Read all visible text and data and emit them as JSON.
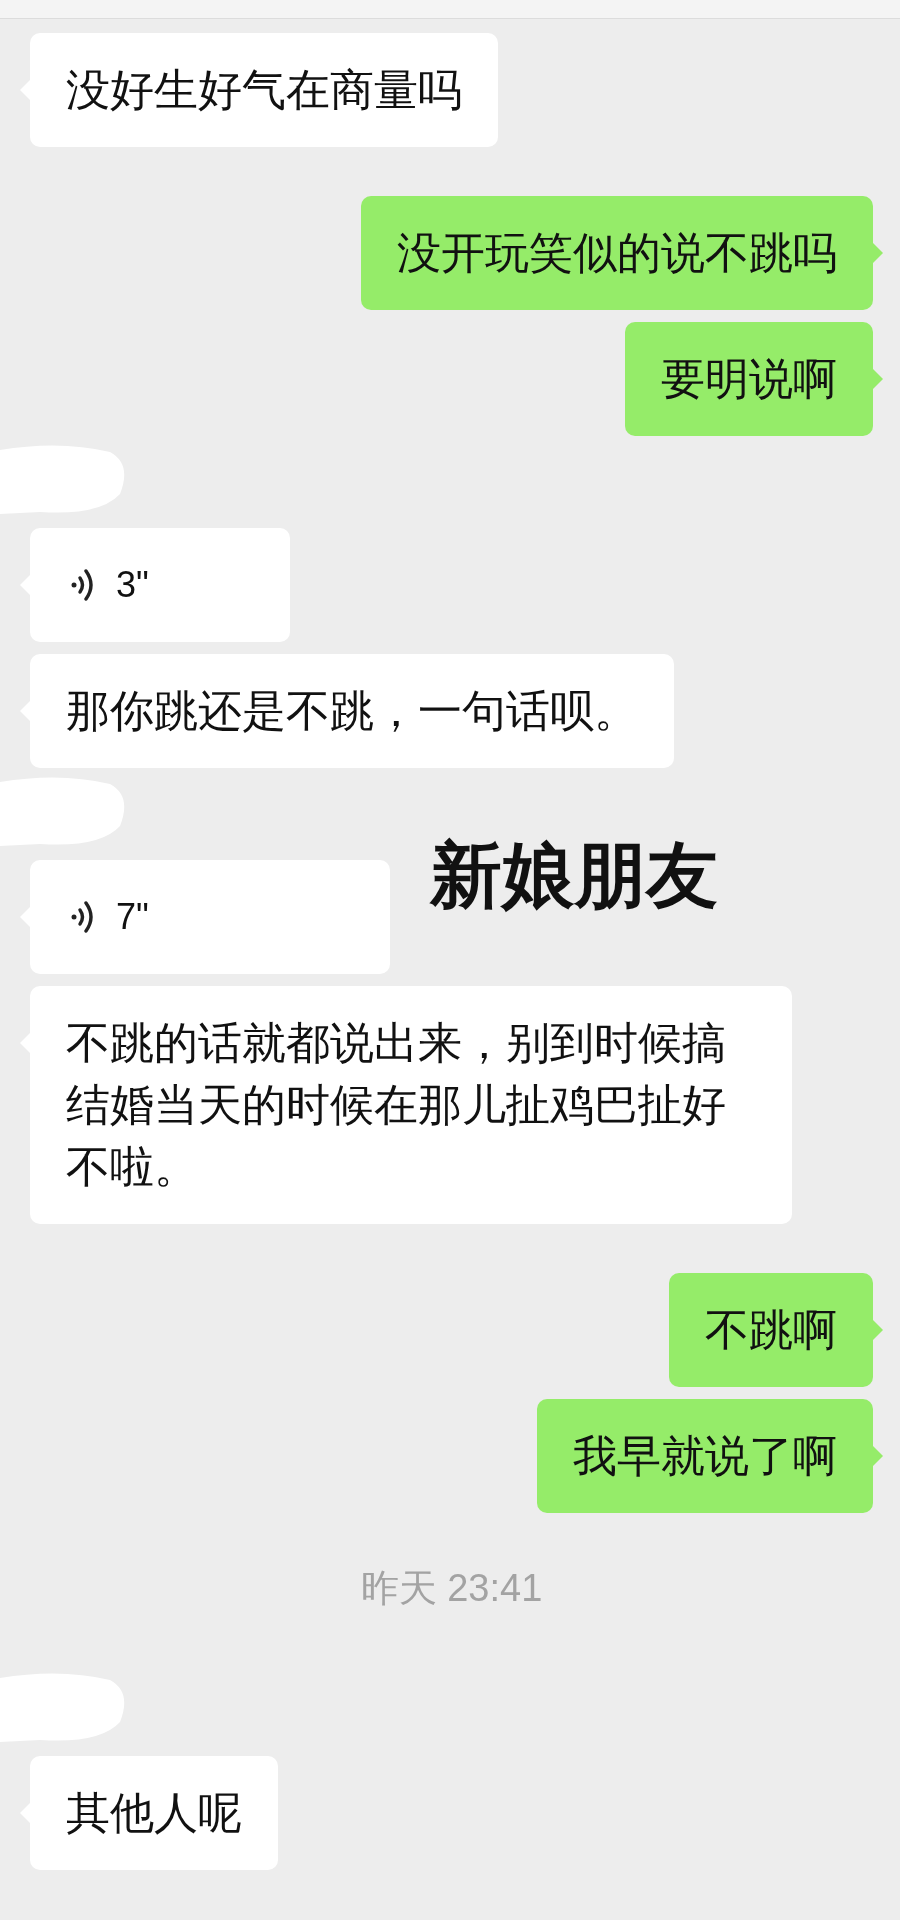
{
  "messages": [
    {
      "kind": "text",
      "outgoing": false,
      "sender_hidden": false,
      "text": "没好生好气在商量吗"
    },
    {
      "kind": "text",
      "outgoing": true,
      "sender_hidden": false,
      "text": "没开玩笑似的说不跳吗"
    },
    {
      "kind": "text",
      "outgoing": true,
      "sender_hidden": false,
      "text": "要明说啊"
    },
    {
      "kind": "voice",
      "outgoing": false,
      "sender_hidden": true,
      "duration": "3\""
    },
    {
      "kind": "text",
      "outgoing": false,
      "sender_hidden": false,
      "text": "那你跳还是不跳，一句话呗。"
    },
    {
      "kind": "voice",
      "outgoing": false,
      "sender_hidden": true,
      "duration": "7\"",
      "annotation": "新娘朋友"
    },
    {
      "kind": "text",
      "outgoing": false,
      "sender_hidden": false,
      "text": "不跳的话就都说出来，别到时候搞结婚当天的时候在那儿扯鸡巴扯好不啦。"
    },
    {
      "kind": "text",
      "outgoing": true,
      "sender_hidden": false,
      "text": "不跳啊"
    },
    {
      "kind": "text",
      "outgoing": true,
      "sender_hidden": false,
      "text": "我早就说了啊"
    },
    {
      "kind": "time",
      "text": "昨天 23:41"
    },
    {
      "kind": "text",
      "outgoing": false,
      "sender_hidden": true,
      "text": "其他人呢"
    }
  ]
}
